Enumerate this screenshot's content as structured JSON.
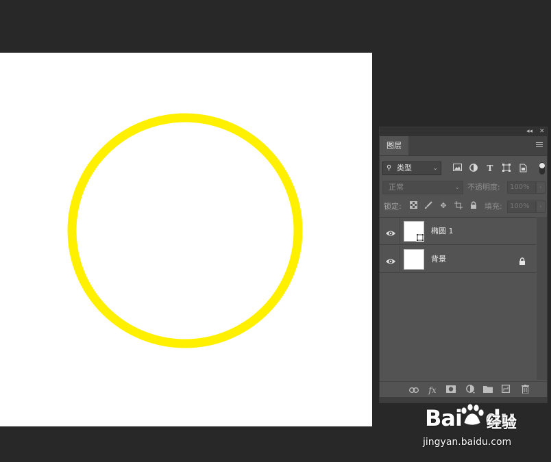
{
  "colors": {
    "workspace": "#282828",
    "canvas": "#ffffff",
    "circle_stroke": "#FFF000",
    "panel": "#535353"
  },
  "panel": {
    "tab_label": "图层",
    "filter": {
      "kind_label": "类型",
      "icons": [
        "image-filter-icon",
        "adjustment-filter-icon",
        "type-filter-icon",
        "shape-filter-icon",
        "smart-object-filter-icon"
      ]
    },
    "blend_mode": "正常",
    "opacity_label": "不透明度:",
    "opacity_value": "100%",
    "lock_label": "锁定:",
    "fill_label": "填充:",
    "fill_value": "100%",
    "layers": [
      {
        "name": "椭圆 1",
        "type": "shape"
      },
      {
        "name": "背景",
        "type": "background",
        "locked": true
      }
    ],
    "footer_icons": [
      "link-layers-icon",
      "fx-icon",
      "add-mask-icon",
      "adjustment-layer-icon",
      "new-group-icon",
      "new-layer-icon",
      "delete-icon"
    ],
    "fx_label": "fx"
  },
  "watermark": {
    "logo_text": "Bai",
    "logo_text2": "du",
    "sub_text": "经验",
    "url": "jingyan.baidu.com"
  }
}
